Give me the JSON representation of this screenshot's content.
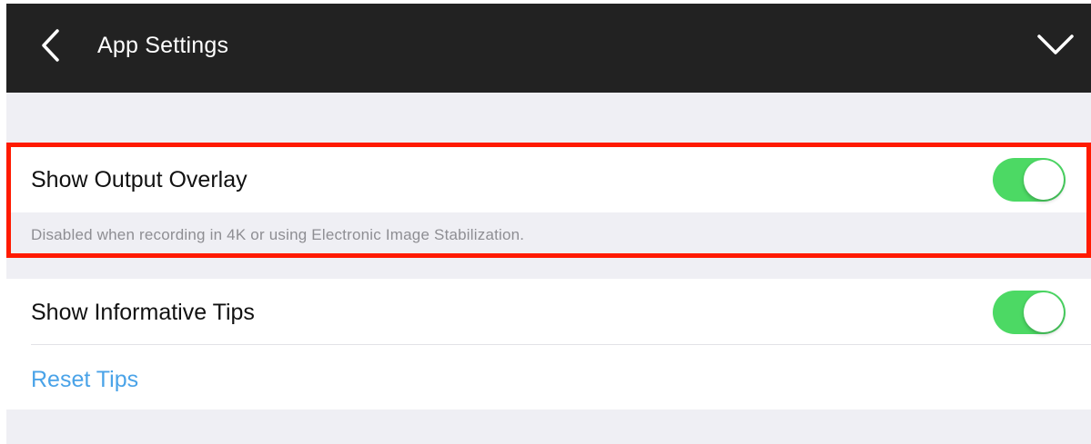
{
  "header": {
    "back_icon": "chevron-left-icon",
    "title": "App Settings",
    "collapse_icon": "chevron-down-icon"
  },
  "settings": {
    "output_overlay": {
      "label": "Show Output Overlay",
      "enabled": true,
      "note": "Disabled when recording in 4K or using Electronic Image Stabilization."
    },
    "informative_tips": {
      "label": "Show Informative Tips",
      "enabled": true
    },
    "reset_tips": {
      "label": "Reset Tips"
    }
  },
  "colors": {
    "navbar": "#222222",
    "background": "#efeff4",
    "toggle_on": "#4cd964",
    "link": "#4aa3e8",
    "highlight": "#ff1a00"
  }
}
